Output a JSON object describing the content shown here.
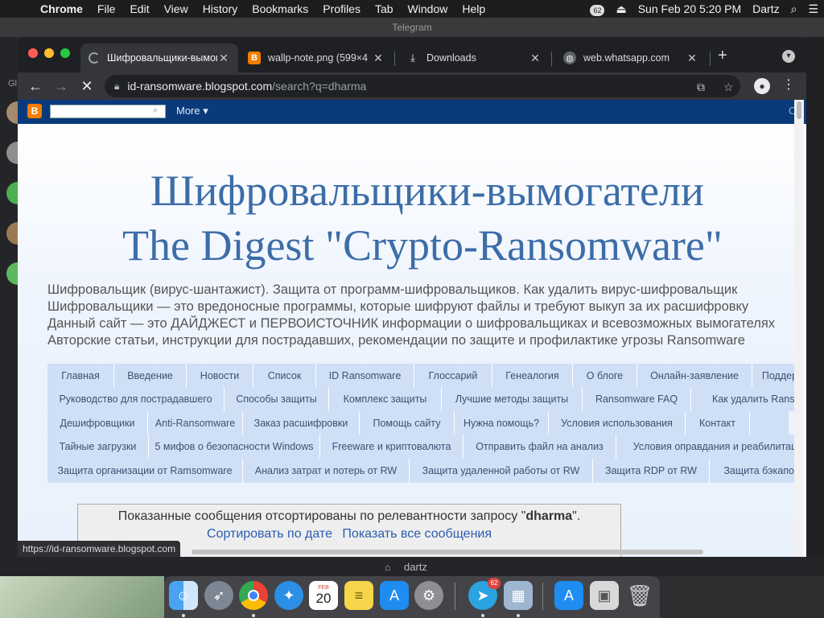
{
  "menubar": {
    "app": "Chrome",
    "items": [
      "File",
      "Edit",
      "View",
      "History",
      "Bookmarks",
      "Profiles",
      "Tab",
      "Window",
      "Help"
    ],
    "badge": "62",
    "datetime": "Sun Feb 20  5:20 PM",
    "user": "Dartz"
  },
  "telegram": {
    "title": "Telegram",
    "sidebar_label": "Gl",
    "bottom_user": "dartz"
  },
  "tabs": [
    {
      "title": "Шифровальщики-вымогатели",
      "active": true
    },
    {
      "title": "wallp-note.png (599×4",
      "active": false
    },
    {
      "title": "Downloads",
      "active": false
    },
    {
      "title": "web.whatsapp.com",
      "active": false
    }
  ],
  "omnibox": {
    "domain": "id-ransomware.blogspot.com",
    "path": "/search?q=dharma"
  },
  "navbar": {
    "more_label": "More ▾",
    "right_char": "C"
  },
  "header": {
    "title_line1": "Шифровальщики-вымогатели",
    "title_line2": "The Digest \"Crypto-Ransomware\"",
    "desc": [
      "Шифровальщик (вирус-шантажист). Защита от программ-шифровальщиков. Как удалить вирус-шифровальщик",
      "Шифровальщики — это вредоносные программы, которые шифруют файлы и требуют выкуп за их расшифровку",
      "Данный сайт — это ДАЙДЖЕСТ и ПЕРВОИСТОЧНИК информации о шифровальщиках и всевозможных вымогателях",
      "Авторские статьи, инструкции для пострадавших, рекомендации по защите и профилактике угрозы Ransomware"
    ]
  },
  "menu_rows": [
    [
      "Главная",
      "Введение",
      "Новости",
      "Список",
      "ID Ransomware",
      "Глоссарий",
      "Генеалогия",
      "О блоге",
      "Онлайн-заявление",
      "Поддержка"
    ],
    [
      "Руководство для пострадавшего",
      "Способы защиты",
      "Комплекс защиты",
      "Лучшие методы защиты",
      "Ransomware FAQ",
      "Как удалить Ransomware"
    ],
    [
      "Дешифровщики",
      "Anti-Ransomware",
      "Заказ расшифровки",
      "Помощь сайту",
      "Нужна помощь?",
      "Условия использования",
      "Контакт"
    ],
    [
      "Тайные загрузки",
      "5 мифов о безопасности Windows",
      "Freeware и криптовалюта",
      "Отправить файл на анализ",
      "Условия оправдания и реабилитации"
    ],
    [
      "Защита организации от Ramsomware",
      "Анализ затрат и потерь от RW",
      "Защита удаленной работы от RW",
      "Защита RDP от RW",
      "Защита бэкапов"
    ]
  ],
  "status": {
    "line1_prefix": "Показанные сообщения отсортированы по релевантности запросу \"",
    "query": "dharma",
    "line1_suffix": "\".",
    "sort_by_date": "Сортировать по дате",
    "show_all": "Показать все сообщения"
  },
  "status_url": "https://id-ransomware.blogspot.com",
  "dock": {
    "calendar_month": "FEB",
    "calendar_day": "20",
    "telegram_badge": "62",
    "icons": [
      "finder-icon",
      "launchpad-icon",
      "chrome-icon",
      "safari-icon",
      "calendar-icon",
      "notes-icon",
      "app-store-icon",
      "system-preferences-icon",
      "telegram-icon",
      "preview-icon",
      "app-store-downloads-icon",
      "image-folder-icon",
      "trash-icon"
    ]
  }
}
